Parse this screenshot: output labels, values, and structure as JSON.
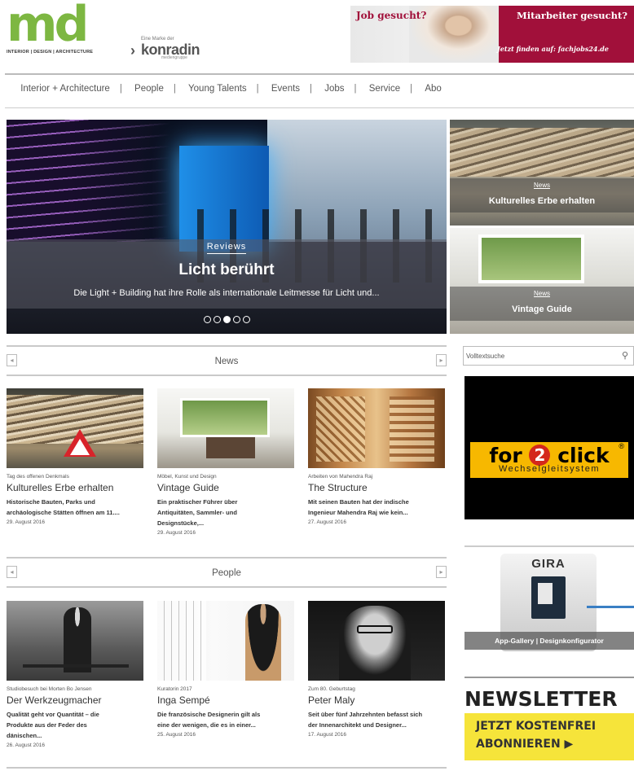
{
  "header": {
    "logo_letters": "md",
    "logo_tagline": "INTERIOR | DESIGN | ARCHITECTURE",
    "publisher_pre": "Eine Marke der",
    "publisher_name": "konradin",
    "publisher_post": "mediengruppe",
    "banner": {
      "left_text": "Job gesucht?",
      "right_text": "Mitarbeiter gesucht?",
      "cta_prefix": "Jetzt finden auf:",
      "cta_brand": "fachjobs24.de",
      "accent_color": "#a1103a"
    }
  },
  "nav": {
    "items": [
      "Interior + Architecture",
      "People",
      "Young Talents",
      "Events",
      "Jobs",
      "Service",
      "Abo"
    ],
    "separator": "|"
  },
  "hero": {
    "category": "Reviews",
    "title": "Licht berührt",
    "description": "Die Light + Building hat ihre Rolle als internationale Leitmesse für Licht und...",
    "slide_count": 5,
    "active_slide": 3
  },
  "side_tiles": [
    {
      "category": "News",
      "title": "Kulturelles Erbe erhalten"
    },
    {
      "category": "News",
      "title": "Vintage Guide"
    }
  ],
  "news": {
    "label": "News",
    "prev_icon": "chevron-left-icon",
    "next_icon": "chevron-right-icon",
    "cards": [
      {
        "kicker": "Tag des offenen Denkmals",
        "title": "Kulturelles Erbe erhalten",
        "teaser_1": "Historische Bauten, Parks und",
        "teaser_2": "archäologische Stätten öffnen am 11....",
        "date": "29. August 2016"
      },
      {
        "kicker": "Möbel, Kunst und Design",
        "title": "Vintage Guide",
        "teaser_1": "Ein praktischer Führer über",
        "teaser_2": "Antiquitäten, Sammler- und",
        "teaser_3": "Designstücke,...",
        "date": "29. August 2016"
      },
      {
        "kicker": "Arbeiten von Mahendra Raj",
        "title": "The Structure",
        "teaser_1": "Mit seinen Bauten hat der indische",
        "teaser_2": "Ingenieur Mahendra Raj wie kein...",
        "date": "27. August 2016"
      }
    ]
  },
  "people": {
    "label": "People",
    "cards": [
      {
        "kicker": "Studiobesuch bei Morten Bo Jensen",
        "title": "Der Werkzeugmacher",
        "teaser_1": "Qualität geht vor Quantität – die",
        "teaser_2": "Produkte aus der Feder des",
        "teaser_3": "dänischen...",
        "date": "26. August 2016"
      },
      {
        "kicker": "Kuratorin 2017",
        "title": "Inga Sempé",
        "teaser_1": "Die französische Designerin gilt als",
        "teaser_2": "eine der wenigen, die es in einer...",
        "date": "25. August 2016"
      },
      {
        "kicker": "Zum 80. Geburtstag",
        "title": "Peter Maly",
        "teaser_1": "Seit über fünf Jahrzehnten befasst sich",
        "teaser_2": "der Innenarchitekt und Designer...",
        "date": "17. August 2016"
      }
    ]
  },
  "sidebar": {
    "search_placeholder": "Volltextsuche",
    "ad_for2click": {
      "pre": "for",
      "num": "2",
      "post": "click",
      "reg": "®",
      "sub": "Wechselgleitsystem"
    },
    "ad_gira": {
      "brand": "GIRA",
      "caption": "App-Gallery | Designkonfigurator"
    },
    "newsletter": {
      "title": "NEWSLETTER",
      "line1": "JETZT KOSTENFREI",
      "line2": "ABONNIEREN ▶"
    }
  },
  "colors": {
    "brand_green": "#7db742",
    "ad_yellow": "#f7b800",
    "newsletter_yellow": "#f6e43a"
  }
}
